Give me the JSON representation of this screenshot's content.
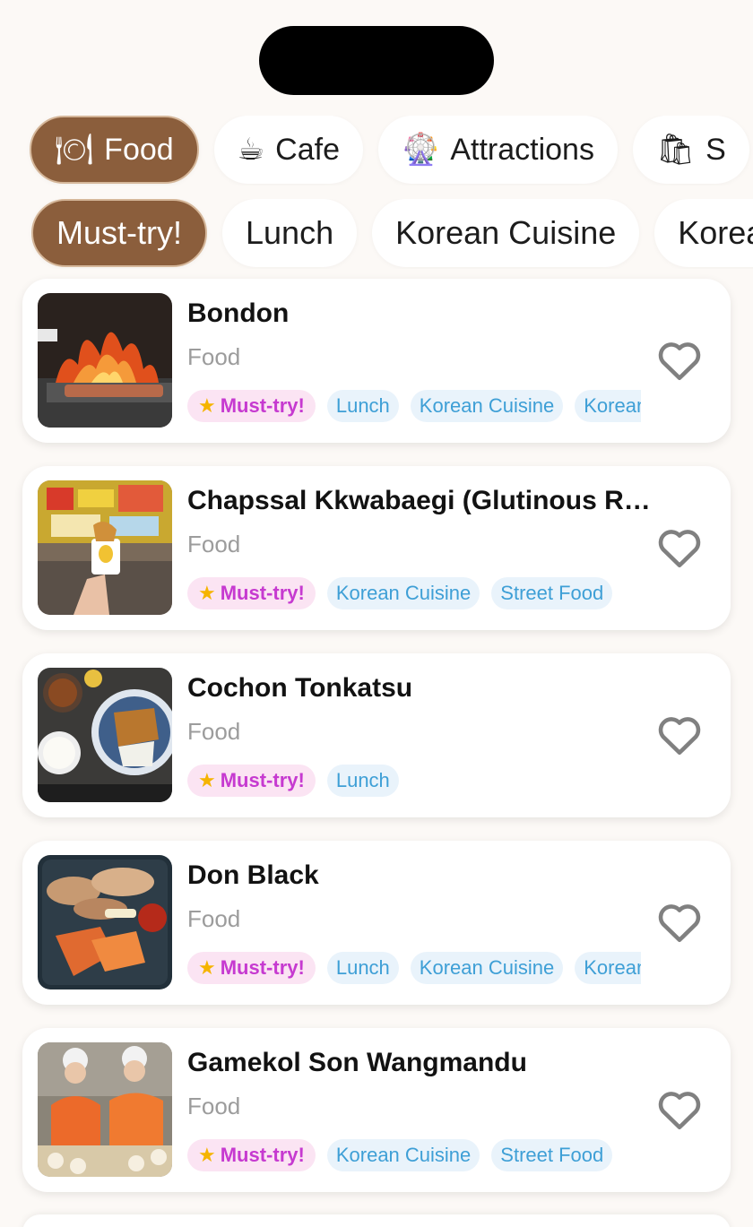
{
  "categories": [
    {
      "icon": "plate-icon",
      "glyph": "🍽",
      "label": "Food",
      "active": true
    },
    {
      "icon": "coffee-icon",
      "glyph": "☕",
      "label": "Cafe",
      "active": false
    },
    {
      "icon": "ferris-wheel-icon",
      "glyph": "🎡",
      "label": "Attractions",
      "active": false
    },
    {
      "icon": "shopping-bag-icon",
      "glyph": "🛍",
      "label": "S",
      "active": false
    }
  ],
  "filters": [
    {
      "label": "Must-try!",
      "active": true
    },
    {
      "label": "Lunch",
      "active": false
    },
    {
      "label": "Korean Cuisine",
      "active": false
    },
    {
      "label": "Korean",
      "active": false
    }
  ],
  "places": [
    {
      "name": "Bondon",
      "category": "Food",
      "image": "grill-flame-photo",
      "must_try": "Must-try!",
      "tags": [
        "Lunch",
        "Korean Cuisine",
        "Korean"
      ]
    },
    {
      "name": "Chapssal Kkwabaegi (Glutinous Rice Twisted Doughnut)",
      "category": "Food",
      "image": "street-snack-cup-photo",
      "must_try": "Must-try!",
      "tags": [
        "Korean Cuisine",
        "Street Food"
      ]
    },
    {
      "name": "Cochon Tonkatsu",
      "category": "Food",
      "image": "tonkatsu-set-photo",
      "must_try": "Must-try!",
      "tags": [
        "Lunch"
      ]
    },
    {
      "name": "Don Black",
      "category": "Food",
      "image": "pork-belly-grill-photo",
      "must_try": "Must-try!",
      "tags": [
        "Lunch",
        "Korean Cuisine",
        "Korean"
      ]
    },
    {
      "name": "Gamekol Son Wangmandu",
      "category": "Food",
      "image": "dumpling-makers-photo",
      "must_try": "Must-try!",
      "tags": [
        "Korean Cuisine",
        "Street Food"
      ]
    }
  ],
  "colors": {
    "accent": "#8b5e3c",
    "must_try_bg": "#fbe4f3",
    "must_try_text": "#c63ad0",
    "tag_bg": "#e9f3fb",
    "tag_text": "#3e9fd6",
    "heart": "#808080"
  }
}
